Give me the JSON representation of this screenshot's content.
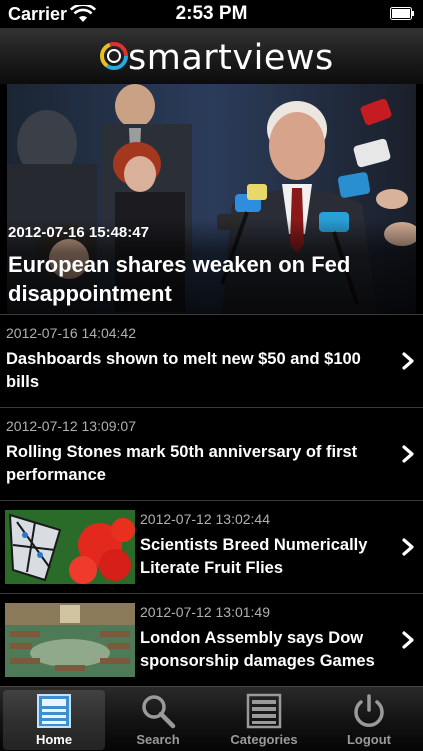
{
  "status_bar": {
    "carrier": "Carrier",
    "time": "2:53 PM"
  },
  "header": {
    "logo_text": "smartviews"
  },
  "featured": {
    "date": "2012-07-16 15:48:47",
    "title": "European shares weaken on Fed disappointment"
  },
  "articles": [
    {
      "date": "2012-07-16 14:04:42",
      "title": "Dashboards shown to melt new $50 and $100 bills",
      "thumbnail": false
    },
    {
      "date": "2012-07-12 13:09:07",
      "title": "Rolling Stones mark 50th anniversary of first performance",
      "thumbnail": false
    },
    {
      "date": "2012-07-12 13:02:44",
      "title": "Scientists Breed Numerically Literate Fruit Flies",
      "thumbnail": true
    },
    {
      "date": "2012-07-12 13:01:49",
      "title": "London Assembly says Dow sponsorship damages Games",
      "thumbnail": true
    }
  ],
  "tabs": [
    {
      "label": "Home",
      "icon": "home-icon",
      "active": true
    },
    {
      "label": "Search",
      "icon": "search-icon",
      "active": false
    },
    {
      "label": "Categories",
      "icon": "categories-icon",
      "active": false
    },
    {
      "label": "Logout",
      "icon": "power-icon",
      "active": false
    }
  ],
  "colors": {
    "background": "#000000",
    "text": "#ffffff",
    "date_text": "#b0b0b0",
    "logo_ring": [
      "#2aa8e0",
      "#e8c020",
      "#e03030"
    ]
  }
}
